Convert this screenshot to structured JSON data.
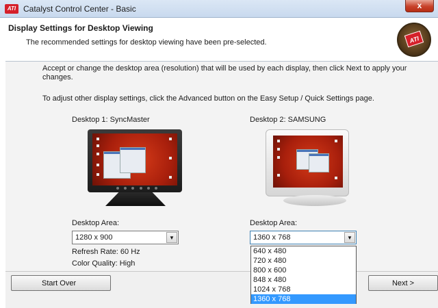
{
  "window": {
    "title": "Catalyst Control Center - Basic",
    "logo_text": "ATI",
    "close_glyph": "x"
  },
  "header": {
    "title": "Display Settings for Desktop Viewing",
    "subtitle": "The recommended settings for desktop viewing have been pre-selected.",
    "badge_text": "ATI"
  },
  "instructions": {
    "line1": "Accept or change the desktop area (resolution) that will be used by each display, then click Next to apply your changes.",
    "line2": "To adjust other display settings, click the Advanced button on the Easy Setup / Quick Settings page."
  },
  "desktop1": {
    "label": "Desktop 1: SyncMaster",
    "area_label": "Desktop Area:",
    "area_value": "1280 x  900",
    "refresh": "Refresh Rate: 60 Hz",
    "color": "Color Quality: High"
  },
  "desktop2": {
    "label": "Desktop 2: SAMSUNG",
    "area_label": "Desktop Area:",
    "area_value": "1360 x 768",
    "options": [
      "640 x 480",
      "720 x 480",
      "800 x 600",
      "848 x 480",
      "1024 x 768",
      "1360 x 768"
    ],
    "selected_index": 5
  },
  "buttons": {
    "start_over": "Start Over",
    "next": "Next >"
  },
  "colors": {
    "selection": "#3399ff",
    "close_button": "#c8422a",
    "ati_red": "#d5202a"
  }
}
